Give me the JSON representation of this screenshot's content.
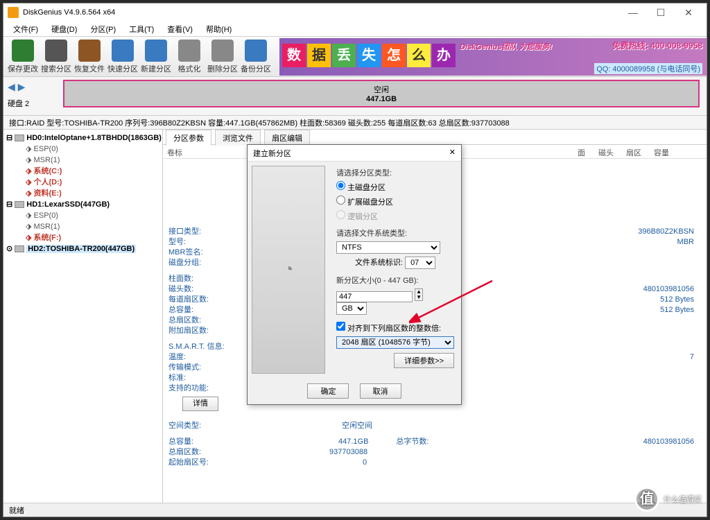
{
  "title": "DiskGenius V4.9.6.564 x64",
  "menu": [
    "文件(F)",
    "硬盘(D)",
    "分区(P)",
    "工具(T)",
    "查看(V)",
    "帮助(H)"
  ],
  "toolbar": [
    {
      "label": "保存更改",
      "color": "#2e7d32"
    },
    {
      "label": "搜索分区",
      "color": "#555"
    },
    {
      "label": "恢复文件",
      "color": "#8d5524"
    },
    {
      "label": "快速分区",
      "color": "#3a7ac0"
    },
    {
      "label": "新建分区",
      "color": "#3a7ac0"
    },
    {
      "label": "格式化",
      "color": "#888"
    },
    {
      "label": "删除分区",
      "color": "#888"
    },
    {
      "label": "备份分区",
      "color": "#3a7ac0"
    }
  ],
  "banner": {
    "chars": [
      "数",
      "据",
      "丢",
      "失",
      "怎",
      "么",
      "办"
    ],
    "line1": "DiskGenius团队 为您服务!",
    "line2": "免费热线: 400-008-9958",
    "line3": "QQ: 4000089958 (与电话同号)"
  },
  "disk": {
    "label": "硬盘 2",
    "part_name": "空闲",
    "part_size": "447.1GB"
  },
  "info": "接口:RAID  型号:TOSHIBA-TR200  序列号:396B80Z2KBSN  容量:447.1GB(457862MB)  柱面数:58369  磁头数:255  每道扇区数:63  总扇区数:937703088",
  "tree": [
    {
      "t": "hd",
      "label": "HD0:IntelOptane+1.8TBHDD(1863GB)"
    },
    {
      "t": "esp",
      "label": "ESP(0)"
    },
    {
      "t": "msr",
      "label": "MSR(1)"
    },
    {
      "t": "pl",
      "label": "系统(C:)"
    },
    {
      "t": "pl",
      "label": "个人(D:)"
    },
    {
      "t": "pl",
      "label": "资料(E:)"
    },
    {
      "t": "hd",
      "label": "HD1:LexarSSD(447GB)"
    },
    {
      "t": "esp",
      "label": "ESP(0)"
    },
    {
      "t": "msr",
      "label": "MSR(1)"
    },
    {
      "t": "pl",
      "label": "系统(F:)"
    },
    {
      "t": "hd",
      "label": "HD2:TOSHIBA-TR200(447GB)",
      "sel": true
    }
  ],
  "tabs": [
    "分区参数",
    "浏览文件",
    "扇区编辑"
  ],
  "thead": {
    "vol": "卷标",
    "c1": "面",
    "c2": "磁头",
    "c3": "扇区",
    "c4": "容量"
  },
  "props": {
    "iface": {
      "k": "接口类型:",
      "v": ""
    },
    "serial_val": "396B80Z2KBSN",
    "model": {
      "k": "型号:",
      "v": ""
    },
    "mbr_val": "MBR",
    "mbrsig": {
      "k": "MBR签名:",
      "v": ""
    },
    "diskgroup": {
      "k": "磁盘分组:",
      "v": ""
    },
    "cyl": {
      "k": "柱面数:",
      "v": ""
    },
    "heads": {
      "k": "磁头数:",
      "v": ""
    },
    "sec_val": "480103981056",
    "spt": {
      "k": "每道扇区数:",
      "v": ""
    },
    "b1": "512 Bytes",
    "cap": {
      "k": "总容量:",
      "v": ""
    },
    "b2": "512 Bytes",
    "tsec": {
      "k": "总扇区数:",
      "v": ""
    },
    "addsec": {
      "k": "附加扇区数:",
      "v": ""
    },
    "smart": {
      "k": "S.M.A.R.T. 信息:",
      "v": ""
    },
    "temp": {
      "k": "温度:",
      "v": ""
    },
    "seven": "7",
    "xfer": {
      "k": "传输模式:",
      "v": ""
    },
    "std": {
      "k": "标准:",
      "v": ""
    },
    "feat": {
      "k": "支持的功能:",
      "v": ""
    },
    "detail_btn": "详情",
    "freetype": {
      "k": "空间类型:",
      "v": "空闲空间"
    },
    "totcap": {
      "k": "总容量:",
      "v": "447.1GB"
    },
    "bytes_k": "总字节数:",
    "bytes_v": "480103981056",
    "totsec": {
      "k": "总扇区数:",
      "v": "937703088"
    },
    "startsec": {
      "k": "起始扇区号:",
      "v": "0"
    }
  },
  "dialog": {
    "title": "建立新分区",
    "l_type": "请选择分区类型:",
    "r1": "主磁盘分区",
    "r2": "扩展磁盘分区",
    "r3": "逻辑分区",
    "l_fs": "请选择文件系统类型:",
    "fs": "NTFS",
    "l_fsid": "文件系统标识:",
    "fsid": "07",
    "l_size": "新分区大小(0 - 447 GB):",
    "size": "447",
    "unit": "GB",
    "chk": "对齐到下列扇区数的整数倍:",
    "align": "2048 扇区 (1048576 字节)",
    "adv": "详细参数>>",
    "ok": "确定",
    "cancel": "取消"
  },
  "status": "就绪",
  "watermark": "什么值得买"
}
